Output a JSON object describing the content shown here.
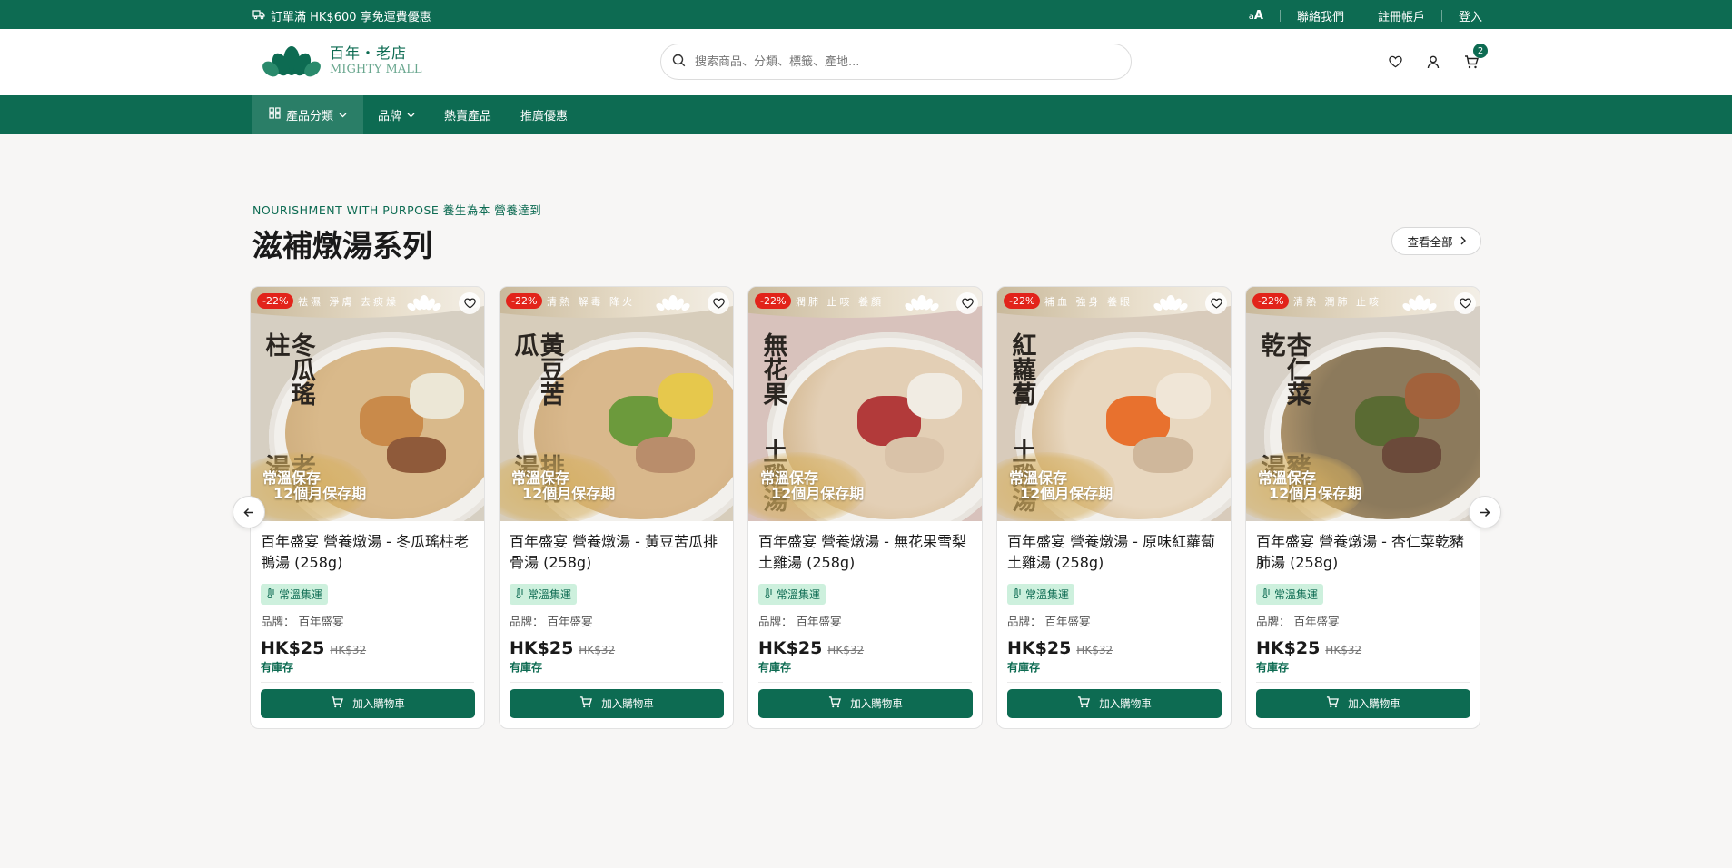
{
  "topbar": {
    "promo": "訂單滿 HK$600 享免運費優惠",
    "font_small": "a",
    "font_big": "A",
    "contact": "聯絡我們",
    "register": "註冊帳戶",
    "login": "登入"
  },
  "header": {
    "logo_cn": "百年・老店",
    "logo_en": "MIGHTY MALL",
    "search_placeholder": "搜索商品、分類、標籤、產地...",
    "cart_count": "2"
  },
  "nav": {
    "items": [
      {
        "label": "產品分類",
        "icon": "grid-icon",
        "dropdown": true,
        "active": true
      },
      {
        "label": "品牌",
        "dropdown": true
      },
      {
        "label": "熱賣產品"
      },
      {
        "label": "推廣優惠"
      }
    ]
  },
  "section": {
    "tagline": "NOURISHMENT WITH PURPOSE 養生為本 營養達到",
    "title": "滋補燉湯系列",
    "view_all": "查看全部"
  },
  "products": [
    {
      "name": "百年盛宴 營養燉湯 - 冬瓜瑤柱老鴨湯 (258g)",
      "discount": "-22%",
      "img_title_a": "冬瓜瑤柱",
      "img_title_b": "老鴨湯",
      "img_top": "祛濕 淨膚 去痰燥",
      "storage_1": "常溫保存",
      "storage_2": "12個月保存期",
      "ship": "常溫集運",
      "brand_label": "品牌：",
      "brand": "百年盛宴",
      "price": "HK$25",
      "old_price": "HK$32",
      "stock": "有庫存",
      "add_label": "加入購物車",
      "colors": {
        "wall": "#d6cfc2",
        "soup": "#d9b98a",
        "ing1": "#c98a4a",
        "ing2": "#ece7d6",
        "ing3": "#8f5a3a"
      }
    },
    {
      "name": "百年盛宴 營養燉湯 - 黃豆苦瓜排骨湯 (258g)",
      "discount": "-22%",
      "img_title_a": "黃豆苦瓜",
      "img_title_b": "排骨湯",
      "img_top": "清熱 解毒 降火",
      "storage_1": "常溫保存",
      "storage_2": "12個月保存期",
      "ship": "常溫集運",
      "brand_label": "品牌：",
      "brand": "百年盛宴",
      "price": "HK$25",
      "old_price": "HK$32",
      "stock": "有庫存",
      "add_label": "加入購物車",
      "colors": {
        "wall": "#d7cdbb",
        "soup": "#d9b88c",
        "ing1": "#6c9a3c",
        "ing2": "#e6c84c",
        "ing3": "#b98d6b"
      }
    },
    {
      "name": "百年盛宴 營養燉湯 - 無花果雪梨土雞湯 (258g)",
      "discount": "-22%",
      "img_title_a": "無花果",
      "img_title_b": "土雞湯",
      "img_top": "潤肺 止咳 養顏",
      "storage_1": "常溫保存",
      "storage_2": "12個月保存期",
      "ship": "常溫集運",
      "brand_label": "品牌：",
      "brand": "百年盛宴",
      "price": "HK$25",
      "old_price": "HK$32",
      "stock": "有庫存",
      "add_label": "加入購物車",
      "colors": {
        "wall": "#d8c2bc",
        "soup": "#e3cfb5",
        "ing1": "#b23a3a",
        "ing2": "#f1ece3",
        "ing3": "#d9c2a8"
      }
    },
    {
      "name": "百年盛宴 營養燉湯 - 原味紅蘿蔔土雞湯 (258g)",
      "discount": "-22%",
      "img_title_a": "紅蘿蔔",
      "img_title_b": "土雞湯",
      "img_top": "補血 強身 養眼",
      "storage_1": "常溫保存",
      "storage_2": "12個月保存期",
      "ship": "常溫集運",
      "brand_label": "品牌：",
      "brand": "百年盛宴",
      "price": "HK$25",
      "old_price": "HK$32",
      "stock": "有庫存",
      "add_label": "加入購物車",
      "colors": {
        "wall": "#d8cbbb",
        "soup": "#e8d7bf",
        "ing1": "#e8712e",
        "ing2": "#f0e6d7",
        "ing3": "#cfb79b"
      }
    },
    {
      "name": "百年盛宴 營養燉湯 - 杏仁菜乾豬肺湯 (258g)",
      "discount": "-22%",
      "img_title_a": "杏仁菜乾",
      "img_title_b": "豬肺湯",
      "img_top": "清熱 潤肺 止咳",
      "storage_1": "常溫保存",
      "storage_2": "12個月保存期",
      "ship": "常溫集運",
      "brand_label": "品牌：",
      "brand": "百年盛宴",
      "price": "HK$25",
      "old_price": "HK$32",
      "stock": "有庫存",
      "add_label": "加入購物車",
      "colors": {
        "wall": "#d7d0c6",
        "soup": "#8c7a5c",
        "ing1": "#5a6b33",
        "ing2": "#a2623c",
        "ing3": "#6b4a3a"
      }
    }
  ],
  "colors": {
    "brand": "#0d6b52",
    "discount": "#e2231a",
    "ship_bg": "#cdf0dd"
  }
}
